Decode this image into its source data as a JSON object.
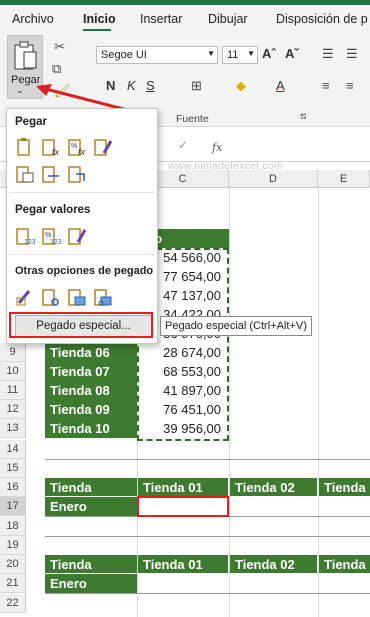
{
  "tabs": [
    "Archivo",
    "Inicio",
    "Insertar",
    "Dibujar",
    "Disposición de p"
  ],
  "ribbon": {
    "paste_label": "Pegar",
    "font_name": "Segoe UI",
    "font_size": "11",
    "bold": "N",
    "italic": "K",
    "underline": "S",
    "font_group_label": "Fuente",
    "grow_font": "Aˆ",
    "shrink_font": "Aˇ",
    "font_color": "A"
  },
  "formula_bar": {
    "fx": "fx"
  },
  "watermark": "www.ninjadelexcel.com",
  "column_headers": [
    "C",
    "D",
    "E"
  ],
  "paste_menu": {
    "section_paste": "Pegar",
    "section_paste_values": "Pegar valores",
    "section_other": "Otras opciones de pegado",
    "paste_special_button": "Pegado especial...",
    "tooltip": "Pegado especial (Ctrl+Alt+V)"
  },
  "sheet": {
    "table1": {
      "header": "ero",
      "visible_values": [
        "54 566,00",
        "77 654,00",
        "47 137,00",
        "34 422,00",
        "36 970,00"
      ],
      "rows": [
        {
          "row": "9",
          "tienda": "Tienda 06",
          "value": "28 674,00"
        },
        {
          "row": "10",
          "tienda": "Tienda 07",
          "value": "68 553,00"
        },
        {
          "row": "11",
          "tienda": "Tienda 08",
          "value": "41 897,00"
        },
        {
          "row": "12",
          "tienda": "Tienda 09",
          "value": "76 451,00"
        },
        {
          "row": "13",
          "tienda": "Tienda 10",
          "value": "39 956,00"
        }
      ]
    },
    "empty_rows": [
      "14",
      "15",
      "18",
      "19",
      "22"
    ],
    "table2": {
      "header_row": "16",
      "data_row": "17",
      "headers": [
        "Tienda",
        "Tienda 01",
        "Tienda 02",
        "Tienda"
      ],
      "label": "Enero"
    },
    "table3": {
      "header_row": "20",
      "data_row": "21",
      "headers": [
        "Tienda",
        "Tienda 01",
        "Tienda 02",
        "Tienda"
      ],
      "label": "Enero"
    }
  },
  "colors": {
    "excel_green": "#217346",
    "table_green": "#3e7a2f",
    "highlight_red": "#e02020"
  }
}
